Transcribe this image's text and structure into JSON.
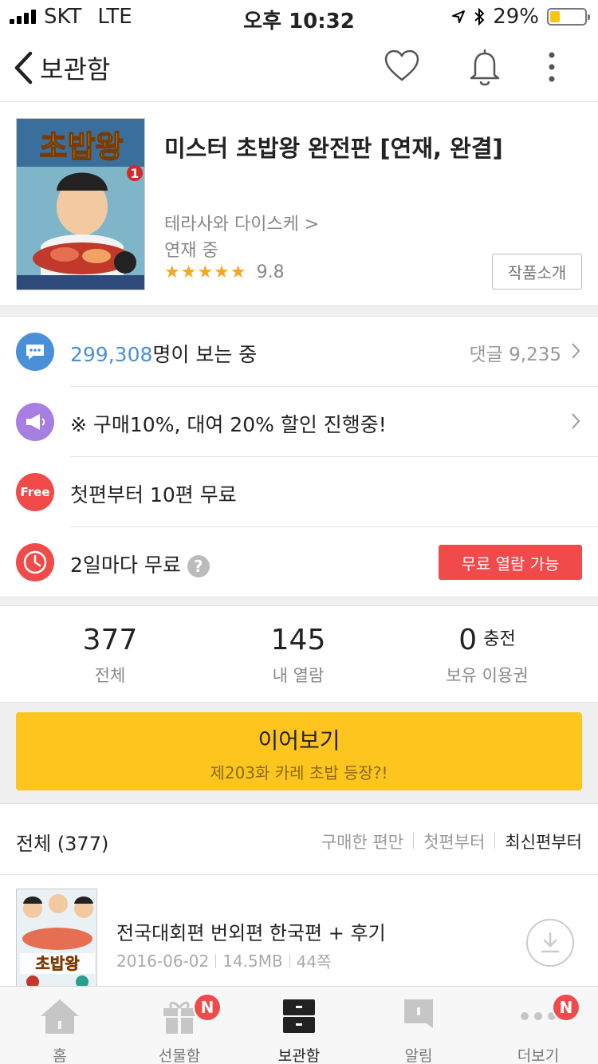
{
  "status_bar": {
    "carrier": "SKT",
    "network": "LTE",
    "time": "오후 10:32",
    "battery_percent": "29%",
    "battery_level": 0.29
  },
  "nav": {
    "back_label": "보관함"
  },
  "book": {
    "title": "미스터 초밥왕 완전판 [연재, 완결]",
    "author": "테라사와 다이스케 >",
    "status": "연재 중",
    "stars": "★★★★★",
    "rating": "9.8",
    "intro_button": "작품소개",
    "cover_title": "초밥왕",
    "cover_volume": "1"
  },
  "info": {
    "viewers_count": "299,308",
    "viewers_suffix": "명이 보는 중",
    "comments": "댓글 9,235",
    "promo": "※ 구매10%, 대여 20% 할인 진행중!",
    "free_first": "첫편부터 10편 무료",
    "free_every": "2일마다 무료",
    "help": "?",
    "free_open_button": "무료 열람 가능",
    "free_icon_label": "Free"
  },
  "stats": {
    "total_num": "377",
    "total_label": "전체",
    "my_num": "145",
    "my_label": "내 열람",
    "ticket_num": "0",
    "charge_label": "충전",
    "ticket_label": "보유 이용권"
  },
  "continue_button": {
    "title": "이어보기",
    "subtitle": "제203화 카레 초밥 등장?!"
  },
  "list": {
    "title": "전체 (377)",
    "sort_purchased": "구매한 편만",
    "sort_first": "첫편부터",
    "sort_latest": "최신편부터"
  },
  "episode": {
    "title": "전국대회편 번외편 한국편 + 후기",
    "date": "2016-06-02",
    "size": "14.5MB",
    "pages": "44쪽",
    "thumb_title": "초밥왕"
  },
  "tabs": [
    {
      "label": "홈",
      "icon": "home-icon",
      "badge": ""
    },
    {
      "label": "선물함",
      "icon": "gift-icon",
      "badge": "N"
    },
    {
      "label": "보관함",
      "icon": "archive-icon",
      "badge": ""
    },
    {
      "label": "알림",
      "icon": "notification-icon",
      "badge": ""
    },
    {
      "label": "더보기",
      "icon": "more-icon",
      "badge": "N"
    }
  ],
  "colors": {
    "accent_blue": "#4a90d9",
    "yellow_button": "#fdc51e",
    "red": "#f04a4a",
    "purple": "#a77fe0",
    "star": "#f5a623"
  }
}
